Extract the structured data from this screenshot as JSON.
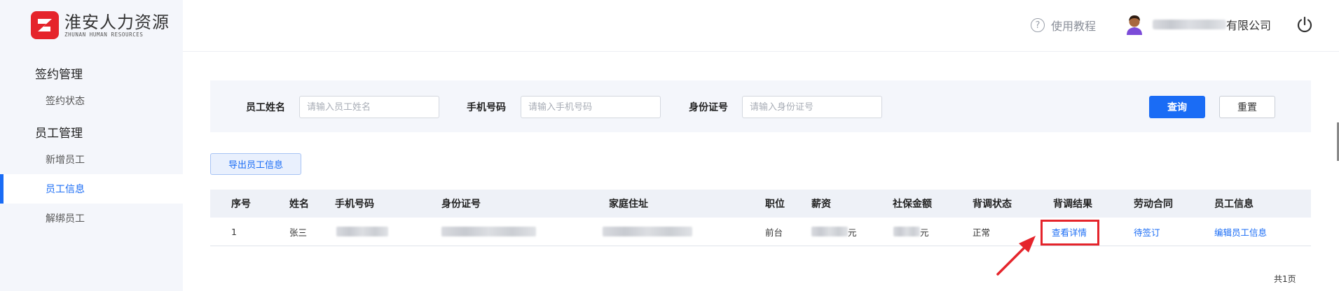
{
  "app": {
    "logo_cn": "淮安人力资源",
    "logo_en": "ZHUNAN HUMAN RESOURCES",
    "brand_color": "#e5242b",
    "accent_color": "#1a6cf5"
  },
  "header": {
    "help_label": "使用教程",
    "company_suffix": "有限公司",
    "icons": [
      "question-circle-icon",
      "avatar-icon",
      "power-icon"
    ]
  },
  "sidebar": {
    "groups": [
      {
        "title": "签约管理",
        "items": [
          {
            "label": "签约状态",
            "active": false
          }
        ]
      },
      {
        "title": "员工管理",
        "items": [
          {
            "label": "新增员工",
            "active": false
          },
          {
            "label": "员工信息",
            "active": true
          },
          {
            "label": "解绑员工",
            "active": false
          }
        ]
      }
    ]
  },
  "filter": {
    "name_label": "员工姓名",
    "name_placeholder": "请输入员工姓名",
    "phone_label": "手机号码",
    "phone_placeholder": "请输入手机号码",
    "id_label": "身份证号",
    "id_placeholder": "请输入身份证号",
    "search_button": "查询",
    "reset_button": "重置"
  },
  "export_button": "导出员工信息",
  "table": {
    "columns": [
      "序号",
      "姓名",
      "手机号码",
      "身份证号",
      "家庭住址",
      "职位",
      "薪资",
      "社保金额",
      "背调状态",
      "背调结果",
      "劳动合同",
      "员工信息"
    ],
    "rows": [
      {
        "index": "1",
        "name": "张三",
        "position": "前台",
        "salary_unit": "元",
        "insurance_unit": "元",
        "bg_status": "正常",
        "bg_result": "查看详情",
        "contract": "待签订",
        "employee_info": "编辑员工信息"
      }
    ]
  },
  "pager": {
    "total_text": "共1页"
  },
  "annotation": {
    "highlight_color": "#e5242b"
  }
}
